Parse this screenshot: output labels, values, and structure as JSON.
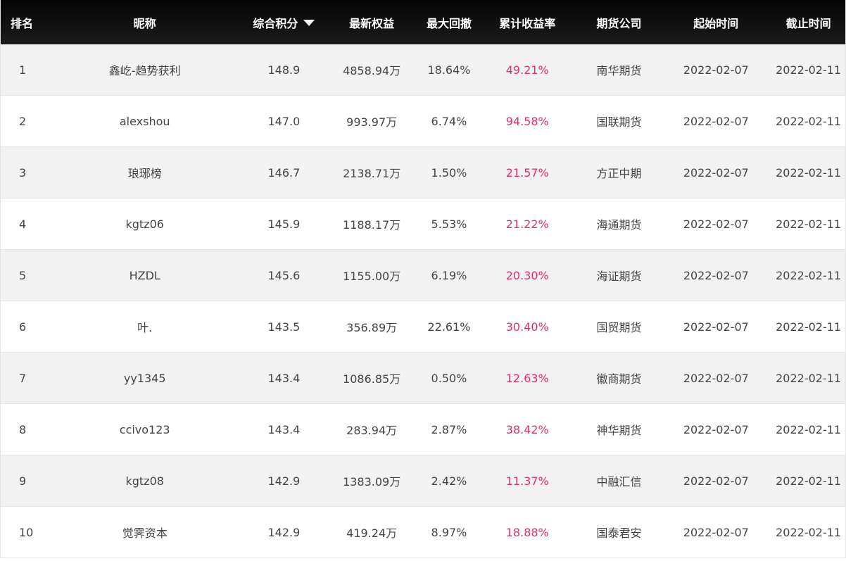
{
  "columns": {
    "rank": "排名",
    "name": "昵称",
    "score": "综合积分",
    "equity": "最新权益",
    "max_drawdown": "最大回撤",
    "cum_return": "累计收益率",
    "broker": "期货公司",
    "start": "起始时间",
    "end": "截止时间"
  },
  "sort": {
    "column": "score",
    "direction": "desc",
    "icon": "caret-down-icon"
  },
  "colors": {
    "header_bg": "#0d0d0d",
    "return_text": "#e0306a",
    "row_alt_bg": "#f2f2f2"
  },
  "rows": [
    {
      "rank": "1",
      "name": "鑫屹-趋势获利",
      "score": "148.9",
      "equity": "4858.94万",
      "max_drawdown": "18.64%",
      "cum_return": "49.21%",
      "broker": "南华期货",
      "start": "2022-02-07",
      "end": "2022-02-11"
    },
    {
      "rank": "2",
      "name": "alexshou",
      "score": "147.0",
      "equity": "993.97万",
      "max_drawdown": "6.74%",
      "cum_return": "94.58%",
      "broker": "国联期货",
      "start": "2022-02-07",
      "end": "2022-02-11"
    },
    {
      "rank": "3",
      "name": "琅琊榜",
      "score": "146.7",
      "equity": "2138.71万",
      "max_drawdown": "1.50%",
      "cum_return": "21.57%",
      "broker": "方正中期",
      "start": "2022-02-07",
      "end": "2022-02-11"
    },
    {
      "rank": "4",
      "name": "kgtz06",
      "score": "145.9",
      "equity": "1188.17万",
      "max_drawdown": "5.53%",
      "cum_return": "21.22%",
      "broker": "海通期货",
      "start": "2022-02-07",
      "end": "2022-02-11"
    },
    {
      "rank": "5",
      "name": "HZDL",
      "score": "145.6",
      "equity": "1155.00万",
      "max_drawdown": "6.19%",
      "cum_return": "20.30%",
      "broker": "海证期货",
      "start": "2022-02-07",
      "end": "2022-02-11"
    },
    {
      "rank": "6",
      "name": "叶.",
      "score": "143.5",
      "equity": "356.89万",
      "max_drawdown": "22.61%",
      "cum_return": "30.40%",
      "broker": "国贸期货",
      "start": "2022-02-07",
      "end": "2022-02-11"
    },
    {
      "rank": "7",
      "name": "yy1345",
      "score": "143.4",
      "equity": "1086.85万",
      "max_drawdown": "0.50%",
      "cum_return": "12.63%",
      "broker": "徽商期货",
      "start": "2022-02-07",
      "end": "2022-02-11"
    },
    {
      "rank": "8",
      "name": "ccivo123",
      "score": "143.4",
      "equity": "283.94万",
      "max_drawdown": "2.87%",
      "cum_return": "38.42%",
      "broker": "神华期货",
      "start": "2022-02-07",
      "end": "2022-02-11"
    },
    {
      "rank": "9",
      "name": "kgtz08",
      "score": "142.9",
      "equity": "1383.09万",
      "max_drawdown": "2.42%",
      "cum_return": "11.37%",
      "broker": "中融汇信",
      "start": "2022-02-07",
      "end": "2022-02-11"
    },
    {
      "rank": "10",
      "name": "觉霁资本",
      "score": "142.9",
      "equity": "419.24万",
      "max_drawdown": "8.97%",
      "cum_return": "18.88%",
      "broker": "国泰君安",
      "start": "2022-02-07",
      "end": "2022-02-11"
    }
  ]
}
